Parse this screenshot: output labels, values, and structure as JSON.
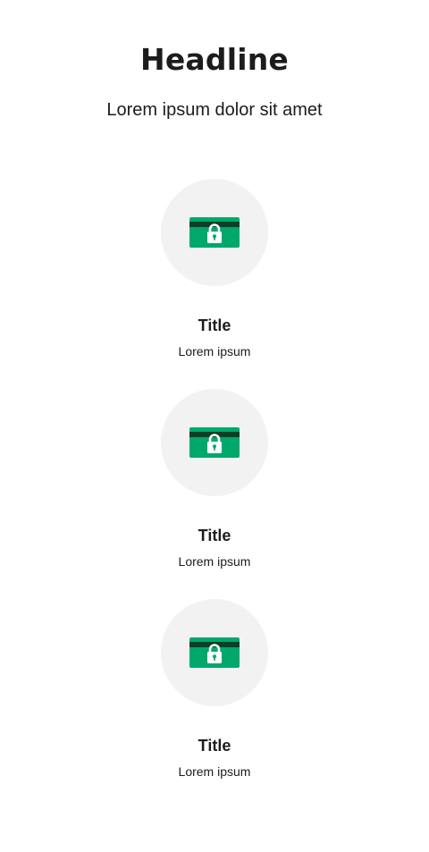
{
  "header": {
    "headline": "Headline",
    "subheadline": "Lorem ipsum dolor sit amet"
  },
  "features": [
    {
      "title": "Title",
      "description": "Lorem ipsum",
      "icon": "lock-card-icon"
    },
    {
      "title": "Title",
      "description": "Lorem ipsum",
      "icon": "lock-card-icon"
    },
    {
      "title": "Title",
      "description": "Lorem ipsum",
      "icon": "lock-card-icon"
    }
  ],
  "colors": {
    "icon_circle_bg": "#f2f2f2",
    "card_green": "#00a86b",
    "card_stripe": "#0f3d25",
    "text": "#1c1c1c"
  }
}
